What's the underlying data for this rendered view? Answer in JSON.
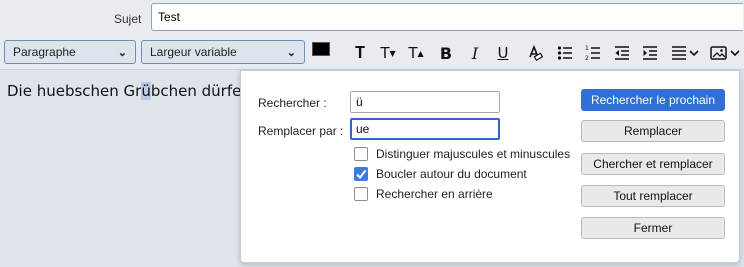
{
  "header": {
    "subject_label": "Sujet",
    "subject_value": "Test"
  },
  "toolbar": {
    "paragraph_format": "Paragraphe",
    "font": "Largeur variable",
    "text_color": "#000000",
    "background_color": "#ffffff",
    "icons": [
      "smaller-text-icon",
      "text-size-decrease-icon",
      "larger-text-icon",
      "bold-icon",
      "italic-icon",
      "underline-icon",
      "remove-formatting-icon",
      "bulleted-list-icon",
      "numbered-list-icon",
      "decrease-indent-icon",
      "increase-indent-icon",
      "align-menu-icon",
      "insert-image-menu-icon"
    ],
    "glyphs": {
      "bold": "B",
      "italic": "I",
      "underline": "U"
    }
  },
  "editor": {
    "text_before": "Die huebschen Gr",
    "text_selected": "ü",
    "text_after": "bchen dürfen"
  },
  "find_replace": {
    "find_label": "Rechercher :",
    "find_value": "ü",
    "replace_label": "Remplacer par :",
    "replace_value": "ue",
    "options": [
      {
        "label": "Distinguer majuscules et minuscules",
        "checked": false
      },
      {
        "label": "Boucler autour du document",
        "checked": true
      },
      {
        "label": "Rechercher en arrière",
        "checked": false
      }
    ],
    "buttons": {
      "find_next": "Rechercher le prochain",
      "replace": "Remplacer",
      "replace_and_find": "Chercher et remplacer",
      "replace_all": "Tout remplacer",
      "close": "Fermer"
    }
  }
}
